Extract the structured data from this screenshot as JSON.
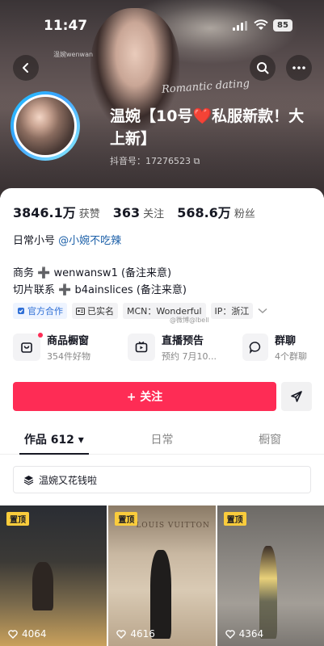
{
  "status_bar": {
    "time": "11:47",
    "battery": "85"
  },
  "banner": {
    "watermark": "温婉wenwan",
    "script_text": "Romantic dating"
  },
  "profile": {
    "name": "温婉【10号❤️私服新款！大上新】",
    "douyin_id": "抖音号：17276523 ⧉"
  },
  "stats": [
    {
      "num": "3846.1万",
      "label": "获赞"
    },
    {
      "num": "363",
      "label": "关注"
    },
    {
      "num": "568.6万",
      "label": "粉丝"
    }
  ],
  "bio": {
    "line1_prefix": "日常小号",
    "line1_link": "@小婉不吃辣",
    "line2": "商务 ➕ wenwansw1 (备注来意)",
    "line3": "切片联系 ➕ b4ainslices (备注来意)"
  },
  "tags": [
    {
      "label": "官方合作",
      "icon": "badge-icon"
    },
    {
      "label": "已实名",
      "icon": "id-card-icon"
    },
    {
      "label": "MCN：Wonderful"
    },
    {
      "label": "IP：浙江"
    }
  ],
  "watermark2": "@微博@lbell",
  "shortcuts": [
    {
      "title": "商品橱窗",
      "sub": "354件好物",
      "icon": "shop-bag-icon"
    },
    {
      "title": "直播预告",
      "sub": "预约 7月10...",
      "icon": "live-tv-icon"
    },
    {
      "title": "群聊",
      "sub": "4个群聊",
      "icon": "chat-icon"
    }
  ],
  "actions": {
    "follow": "+ 关注"
  },
  "tabs": [
    {
      "label": "作品 612 ▾"
    },
    {
      "label": "日常"
    },
    {
      "label": "橱窗"
    }
  ],
  "collection": {
    "label": "温婉又花钱啦"
  },
  "videos": [
    {
      "badge": "置顶",
      "likes": "4064"
    },
    {
      "badge": "置顶",
      "likes": "4616",
      "overlay_text": "LOUIS VUITTON"
    },
    {
      "badge": "置顶",
      "likes": "4364"
    }
  ],
  "colors": {
    "accent": "#fe2c55",
    "link": "#1b5fa8",
    "pin_badge": "#facc3c"
  }
}
